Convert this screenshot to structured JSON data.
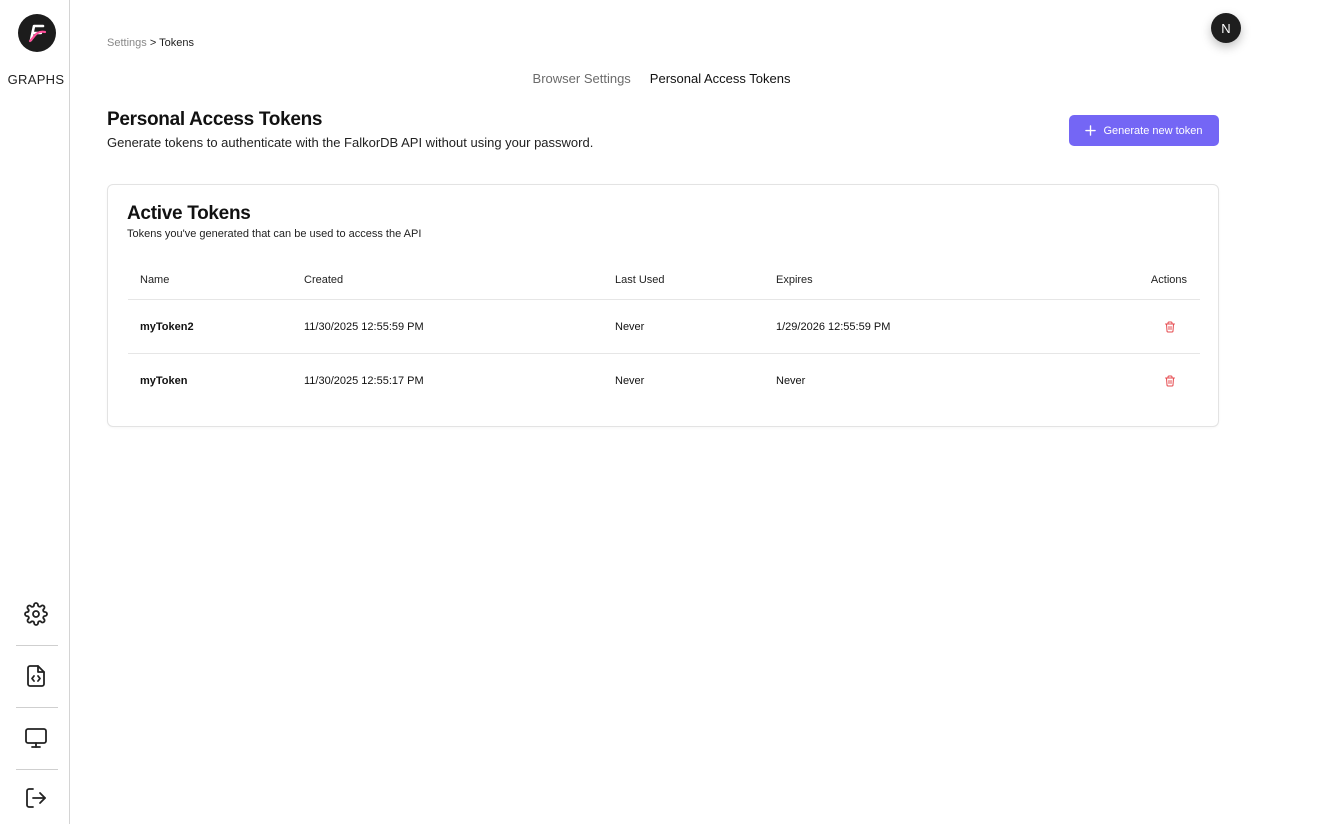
{
  "sidebar": {
    "logo_letter": "F",
    "graphs_label": "GRAPHS",
    "icons": [
      "gear-icon",
      "code-file-icon",
      "monitor-icon",
      "logout-icon"
    ]
  },
  "breadcrumb": {
    "parent": "Settings",
    "separator": ">",
    "current": "Tokens"
  },
  "avatar": {
    "initial": "N"
  },
  "tabs": [
    {
      "label": "Browser Settings",
      "active": false
    },
    {
      "label": "Personal Access Tokens",
      "active": true
    }
  ],
  "page": {
    "title": "Personal Access Tokens",
    "subtitle": "Generate tokens to authenticate with the FalkorDB API without using your password.",
    "generate_button_label": "Generate new token"
  },
  "active_tokens": {
    "title": "Active Tokens",
    "subtitle": "Tokens you've generated that can be used to access the API",
    "columns": [
      "Name",
      "Created",
      "Last Used",
      "Expires",
      "Actions"
    ],
    "rows": [
      {
        "name": "myToken2",
        "created": "11/30/2025 12:55:59 PM",
        "last_used": "Never",
        "expires": "1/29/2026 12:55:59 PM"
      },
      {
        "name": "myToken",
        "created": "11/30/2025 12:55:17 PM",
        "last_used": "Never",
        "expires": "Never"
      }
    ]
  },
  "colors": {
    "accent": "#7466f5",
    "delete_icon": "#e5484d",
    "logo_accent": "#ff4f9a"
  }
}
